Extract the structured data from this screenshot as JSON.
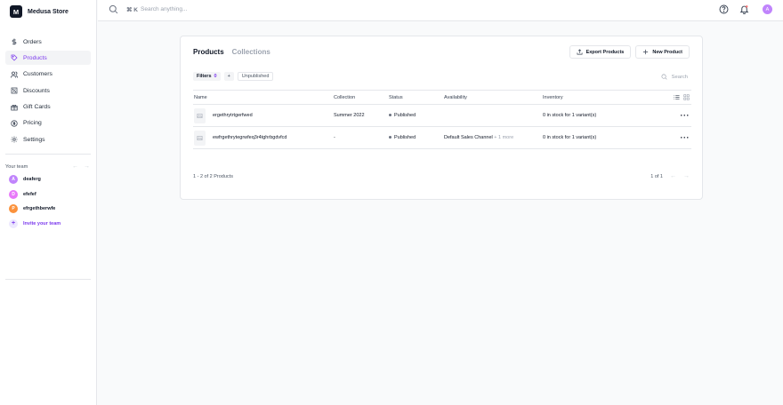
{
  "store": {
    "logo_letter": "M",
    "name": "Medusa Store"
  },
  "nav": {
    "items": [
      {
        "label": "Orders",
        "icon": "dollar-icon"
      },
      {
        "label": "Products",
        "icon": "tag-icon",
        "active": true
      },
      {
        "label": "Customers",
        "icon": "users-icon"
      },
      {
        "label": "Discounts",
        "icon": "discount-icon"
      },
      {
        "label": "Gift Cards",
        "icon": "gift-icon"
      },
      {
        "label": "Pricing",
        "icon": "pricing-icon"
      },
      {
        "label": "Settings",
        "icon": "gear-icon"
      }
    ]
  },
  "team": {
    "heading": "Your team",
    "members": [
      {
        "initial": "A",
        "name": "deaferg",
        "color": "#c084fc"
      },
      {
        "initial": "D",
        "name": "efefef",
        "color": "#e879f9"
      },
      {
        "initial": "P",
        "name": "efrgethberwfe",
        "color": "#fb923c"
      }
    ],
    "invite_icon": "+",
    "invite_label": "Invite your team"
  },
  "topbar": {
    "shortcut": "⌘ K",
    "search_placeholder": "Search anything...",
    "user_initial": "A"
  },
  "main": {
    "tabs": [
      {
        "label": "Products",
        "active": true
      },
      {
        "label": "Collections",
        "active": false
      }
    ],
    "export_label": "Export Products",
    "new_label": "New Product",
    "filters_label": "Filters",
    "filters_count": "0",
    "add_filter": "+",
    "unpublished_chip": "Unpublished",
    "search_placeholder": "Search",
    "columns": [
      "Name",
      "Collection",
      "Status",
      "Availability",
      "Inventory"
    ],
    "rows": [
      {
        "name": "ergethrytrtgerfwed",
        "collection": "Summer 2022",
        "status": "Published",
        "availability": "",
        "more": "",
        "inventory": "0 in stock for 1 variant(s)"
      },
      {
        "name": "ewfrgethrytegrwfeq3r4tghrbgdvfcd",
        "collection": "-",
        "status": "Published",
        "availability": "Default Sales Channel",
        "more": "+ 1 more",
        "inventory": "0 in stock for 1 variant(s)"
      }
    ],
    "row_menu": "···",
    "count_text": "1 - 2 of 2 Products",
    "page_text": "1 of 1"
  },
  "colors": {
    "accent": "#7c3aed",
    "border": "#e5e7eb",
    "background": "#f9fafb"
  }
}
